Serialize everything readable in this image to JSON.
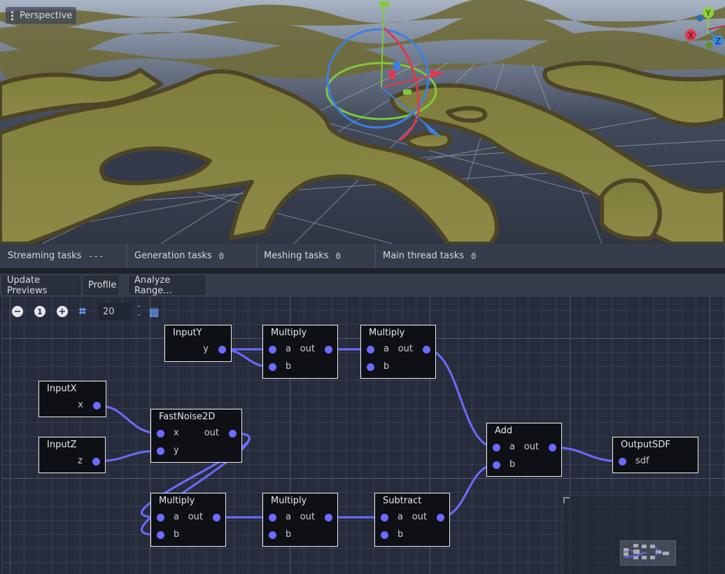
{
  "viewport": {
    "view_mode_label": "Perspective",
    "menu_icon": "kebab-icon",
    "axis_gizmo": {
      "labels": {
        "x": "X",
        "y": "Y",
        "z": "Z"
      },
      "colors": {
        "x": "#e0394f",
        "y": "#8fd13a",
        "z": "#3d8ce0"
      }
    },
    "terrain_colors": {
      "top": "#8a8a3e",
      "side": "#5a4f2a",
      "ground": "#323a4a"
    }
  },
  "status_bar": {
    "items": [
      {
        "label": "Streaming tasks",
        "value": "---"
      },
      {
        "label": "Generation tasks",
        "value": "0"
      },
      {
        "label": "Meshing tasks",
        "value": "0"
      },
      {
        "label": "Main thread tasks",
        "value": "0"
      }
    ]
  },
  "toolbar": {
    "update_previews_label": "Update Previews",
    "profile_label": "Profile",
    "analyze_range_label": "Analyze Range..."
  },
  "graph": {
    "zoom_out_icon": "zoom-out-icon",
    "zoom_reset_icon": "zoom-reset-icon",
    "zoom_reset_glyph": "1",
    "zoom_in_icon": "zoom-in-icon",
    "snap_icon": "snap-grid-icon",
    "snap_value": "20",
    "minimap_icon": "minimap-icon",
    "wire_color": "#6b6bff",
    "nodes": [
      {
        "id": "inputy",
        "title": "InputY",
        "inputs": [],
        "outputs": [
          "y"
        ]
      },
      {
        "id": "mul1",
        "title": "Multiply",
        "inputs": [
          "a",
          "b"
        ],
        "outputs": [
          "out"
        ]
      },
      {
        "id": "mul2",
        "title": "Multiply",
        "inputs": [
          "a",
          "b"
        ],
        "outputs": [
          "out"
        ]
      },
      {
        "id": "inputx",
        "title": "InputX",
        "inputs": [],
        "outputs": [
          "x"
        ]
      },
      {
        "id": "inputz",
        "title": "InputZ",
        "inputs": [],
        "outputs": [
          "z"
        ]
      },
      {
        "id": "noise",
        "title": "FastNoise2D",
        "inputs": [
          "x",
          "y"
        ],
        "outputs": [
          "out"
        ]
      },
      {
        "id": "add",
        "title": "Add",
        "inputs": [
          "a",
          "b"
        ],
        "outputs": [
          "out"
        ]
      },
      {
        "id": "output",
        "title": "OutputSDF",
        "inputs": [
          "sdf"
        ],
        "outputs": []
      },
      {
        "id": "mul3",
        "title": "Multiply",
        "inputs": [
          "a",
          "b"
        ],
        "outputs": [
          "out"
        ]
      },
      {
        "id": "mul4",
        "title": "Multiply",
        "inputs": [
          "a",
          "b"
        ],
        "outputs": [
          "out"
        ]
      },
      {
        "id": "sub",
        "title": "Subtract",
        "inputs": [
          "a",
          "b"
        ],
        "outputs": [
          "out"
        ]
      }
    ],
    "connections": [
      {
        "from": "inputy.y",
        "to": "mul1.a"
      },
      {
        "from": "inputy.y",
        "to": "mul1.b"
      },
      {
        "from": "mul1.out",
        "to": "mul2.a"
      },
      {
        "from": "mul2.out",
        "to": "add.a"
      },
      {
        "from": "inputx.x",
        "to": "noise.x"
      },
      {
        "from": "inputz.z",
        "to": "noise.y"
      },
      {
        "from": "noise.out",
        "to": "mul3.a"
      },
      {
        "from": "noise.out",
        "to": "mul3.b"
      },
      {
        "from": "mul3.out",
        "to": "mul4.a"
      },
      {
        "from": "mul4.out",
        "to": "sub.a"
      },
      {
        "from": "sub.out",
        "to": "add.b"
      },
      {
        "from": "add.out",
        "to": "output.sdf"
      }
    ]
  }
}
